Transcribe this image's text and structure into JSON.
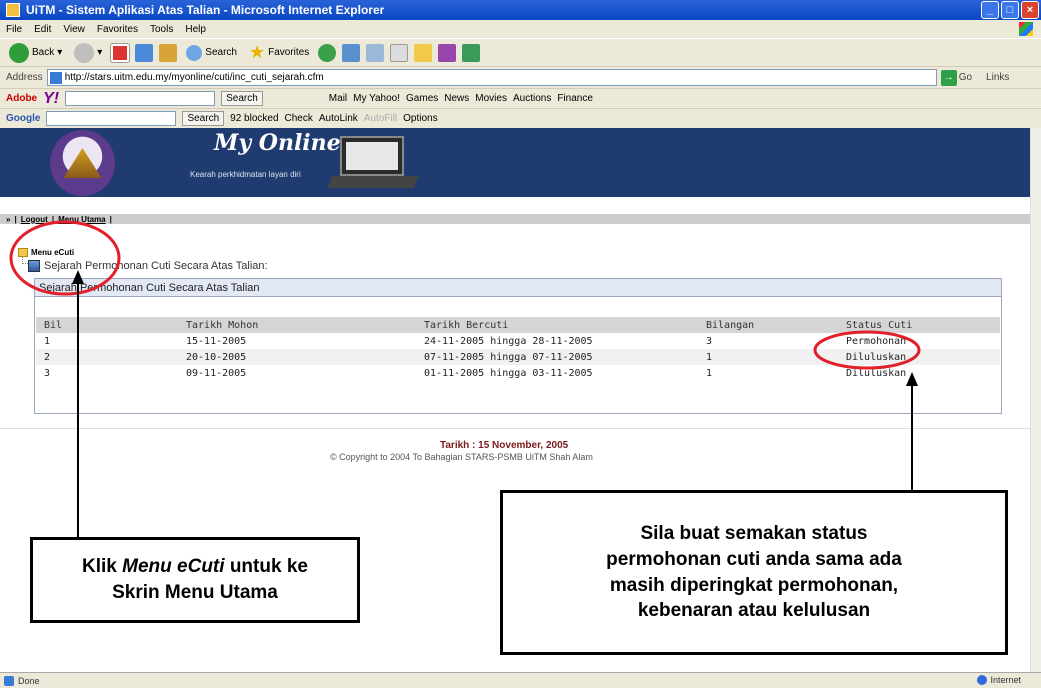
{
  "window": {
    "title": "UiTM - Sistem Aplikasi Atas Talian - Microsoft Internet Explorer"
  },
  "menubar": [
    "File",
    "Edit",
    "View",
    "Favorites",
    "Tools",
    "Help"
  ],
  "toolbar": {
    "back": "Back",
    "search": "Search",
    "favorites": "Favorites"
  },
  "address": {
    "label": "Address",
    "url": "http://stars.uitm.edu.my/myonline/cuti/inc_cuti_sejarah.cfm",
    "go": "Go",
    "links": "Links"
  },
  "yahoo_toolbar": {
    "brand": "Adobe",
    "search_btn": "Search",
    "items": [
      "Mail",
      "My Yahoo!",
      "Games",
      "News",
      "Movies",
      "Auctions",
      "Finance"
    ]
  },
  "google_toolbar": {
    "brand": "Google",
    "search_btn": "Search",
    "blocked": "92 blocked",
    "check": "Check",
    "autolink": "AutoLink",
    "autofill": "AutoFill",
    "options": "Options"
  },
  "site": {
    "brand": "My Online",
    "tagline": "Kearah perkhidmatan layan diri"
  },
  "nav": {
    "prefix": "»",
    "logout": "Logout",
    "sep": "|",
    "menu_utama": "Menu Utama"
  },
  "menu_ecuti": "Menu eCuti",
  "subtitle": "Sejarah Permohonan Cuti Secara Atas Talian:",
  "panel_title": "Sejarah Permohonan Cuti Secara Atas Talian",
  "table": {
    "headers": [
      "Bil",
      "Tarikh Mohon",
      "Tarikh Bercuti",
      "Bilangan",
      "Status Cuti"
    ],
    "rows": [
      [
        "1",
        "15-11-2005",
        "24-11-2005 hingga 28-11-2005",
        "3",
        "Permohonan"
      ],
      [
        "2",
        "20-10-2005",
        "07-11-2005 hingga 07-11-2005",
        "1",
        "Diluluskan"
      ],
      [
        "3",
        "09-11-2005",
        "01-11-2005 hingga 03-11-2005",
        "1",
        "Diluluskan"
      ]
    ]
  },
  "footer": {
    "date": "Tarikh : 15 November, 2005",
    "copyright": "© Copyright to 2004 To Bahagian STARS-PSMB UiTM Shah Alam"
  },
  "callouts": {
    "left": [
      "Klik ",
      "Menu eCuti",
      " untuk ke",
      "Skrin Menu Utama"
    ],
    "right": [
      "Sila buat semakan status",
      "permohonan cuti anda sama ada",
      "masih diperingkat permohonan,",
      "kebenaran atau kelulusan"
    ]
  },
  "statusbar": {
    "left": "Done",
    "zone": "Internet"
  },
  "colors": {
    "header": "#1f3b6f",
    "annotation_red": "#e2202a",
    "titlebar": "#0a46c4"
  }
}
